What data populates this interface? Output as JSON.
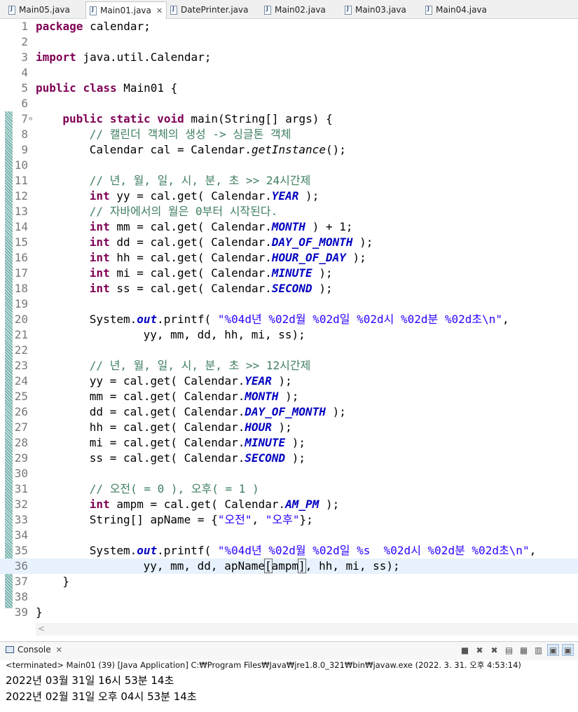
{
  "tabs": [
    {
      "label": "Main05.java",
      "active": false
    },
    {
      "label": "Main01.java",
      "active": true
    },
    {
      "label": "DatePrinter.java",
      "active": false
    },
    {
      "label": "Main02.java",
      "active": false
    },
    {
      "label": "Main03.java",
      "active": false
    },
    {
      "label": "Main04.java",
      "active": false
    }
  ],
  "editor": {
    "line_numbers": [
      "1",
      "2",
      "3",
      "4",
      "5",
      "6",
      "7",
      "8",
      "9",
      "10",
      "11",
      "12",
      "13",
      "14",
      "15",
      "16",
      "17",
      "18",
      "19",
      "20",
      "21",
      "22",
      "23",
      "24",
      "25",
      "26",
      "27",
      "28",
      "29",
      "30",
      "31",
      "32",
      "33",
      "34",
      "35",
      "36",
      "37",
      "38",
      "39"
    ],
    "current_line": "36"
  },
  "code": {
    "pkg": "package",
    "l1": " calendar;",
    "imp": "import",
    "l3": " java.util.Calendar;",
    "pub": "public",
    "cls": "class",
    "l5": " Main01 {",
    "stat": "static",
    "void": "void",
    "l7a": " main(String[] args) {",
    "c8": "// 캘린더 객체의 생성 -> 싱글톤 객체",
    "l9a": "Calendar cal = Calendar.",
    "l9b": "getInstance",
    "l9c": "();",
    "c11": "// 년, 월, 일, 시, 분, 초 >> 24시간제",
    "int": "int",
    "v12": " yy = cal.get( Calendar.",
    "YEAR": "YEAR",
    "end": " );",
    "c13": "// 자바에서의 월은 0부터 시작된다.",
    "v14": " mm = cal.get( Calendar.",
    "MONTH": "MONTH",
    "end14": " ) + 1;",
    "v15": " dd = cal.get( Calendar.",
    "DAY_OF_MONTH": "DAY_OF_MONTH",
    "v16": " hh = cal.get( Calendar.",
    "HOUR_OF_DAY": "HOUR_OF_DAY",
    "v17": " mi = cal.get( Calendar.",
    "MINUTE": "MINUTE",
    "v18": " ss = cal.get( Calendar.",
    "SECOND": "SECOND",
    "sys": "System.",
    "out": "out",
    "printf": ".printf( ",
    "s20": "\"%04d년 %02d월 %02d일 %02d시 %02d분 %02d초\\n\"",
    "comma": ",",
    "l21": "yy, mm, dd, hh, mi, ss);",
    "c23": "// 년, 월, 일, 시, 분, 초 >> 12시간제",
    "l24": "yy = cal.get( Calendar.",
    "l25": "mm = cal.get( Calendar.",
    "l26": "dd = cal.get( Calendar.",
    "l27": "hh = cal.get( Calendar.",
    "HOUR": "HOUR",
    "l28": "mi = cal.get( Calendar.",
    "l29": "ss = cal.get( Calendar.",
    "c31": "// 오전( = 0 ), 오후( = 1 )",
    "v32": " ampm = cal.get( Calendar.",
    "AM_PM": "AM_PM",
    "l33a": "String[] apName = {",
    "s33a": "\"오전\"",
    "l33b": ", ",
    "s33b": "\"오후\"",
    "l33c": "};",
    "s35": "\"%04d년 %02d월 %02d일 %s  %02d시 %02d분 %02d초\\n\"",
    "l36a": "yy, mm, dd, apName",
    "l36b": "[",
    "l36c": "ampm",
    "l36d": "]",
    "l36e": ", hh, mi, ss);",
    "close37": "}",
    "close39": "}"
  },
  "console": {
    "tab_label": "Console",
    "status": "<terminated> Main01 (39) [Java Application] C:₩Program Files₩Java₩jre1.8.0_321₩bin₩javaw.exe (2022. 3. 31. 오후 4:53:14)",
    "output": [
      "2022년 03월 31일 16시 53분 14초",
      "2022년 02월 31일 오후 04시 53분 14초"
    ]
  },
  "colors": {
    "keyword": "#7f0055",
    "comment": "#3f7f5f",
    "string": "#2a00ff",
    "constant": "#0000c0",
    "current_line_bg": "#e8f2fe"
  }
}
